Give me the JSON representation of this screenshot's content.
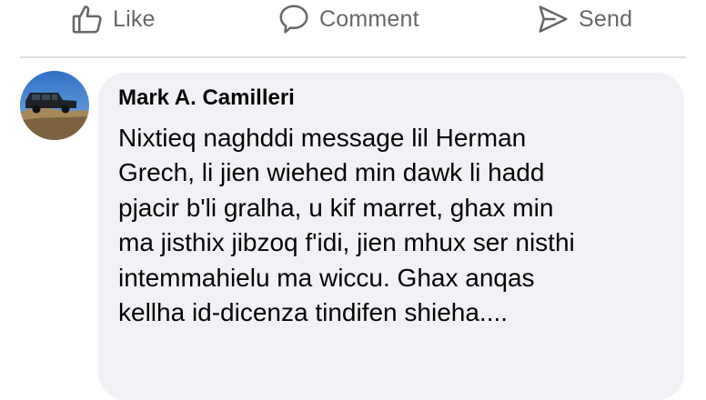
{
  "actions": {
    "like_label": "Like",
    "comment_label": "Comment",
    "send_label": "Send"
  },
  "comment": {
    "author": "Mark A. Camilleri",
    "lines": [
      "Nixtieq naghddi message lil Herman",
      "Grech, li jien wiehed min dawk li hadd",
      "pjacir b'li gralha, u kif marret, ghax min",
      "ma jisthix jibzoq f'idi, jien mhux ser nisthi",
      "intemmahielu ma wiccu. Ghax anqas",
      "kellha id-dicenza tindifen shieha...."
    ]
  },
  "icons": {
    "like": "thumbs-up-icon",
    "comment": "speech-bubble-icon",
    "send": "paper-plane-icon"
  },
  "colors": {
    "action_text": "#65676b",
    "bubble_bg": "#f0f2f5",
    "divider": "#dadde1",
    "text": "#050505"
  }
}
